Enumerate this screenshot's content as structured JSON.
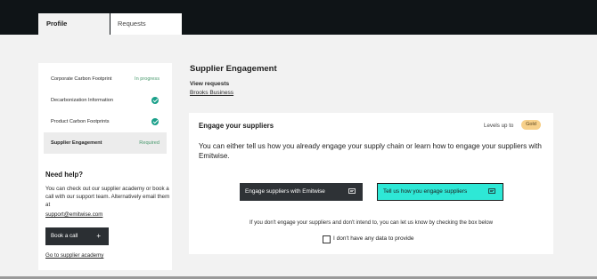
{
  "tabs": {
    "profile": "Profile",
    "requests": "Requests"
  },
  "sidebar": {
    "steps": [
      {
        "label": "Corporate Carbon Footprint",
        "status": "In progress"
      },
      {
        "label": "Decarbonization Information",
        "status": "complete"
      },
      {
        "label": "Product Carbon Footprints",
        "status": "complete"
      },
      {
        "label": "Supplier Engagement",
        "status": "Required"
      }
    ],
    "help": {
      "title": "Need help?",
      "text": "You can check out our supplier academy or book a call with our support team. Alternatively email them at",
      "email": "support@emitwise.com",
      "book_label": "Book a call",
      "book_icon": "+",
      "academy_link": "Go to supplier academy"
    }
  },
  "main": {
    "title": "Supplier Engagement",
    "view_requests": "View requests",
    "company": "Brooks Business",
    "card": {
      "title": "Engage your suppliers",
      "levels_label": "Levels up to",
      "badge": "Gold",
      "description": "You can either tell us how you already engage your supply chain or learn how to engage your suppliers with Emitwise.",
      "btn_emitwise": "Engage suppliers with Emitwise",
      "btn_tell": "Tell us how you engage suppliers",
      "note": "If you don't engage your suppliers and don't intend to, you can let us know by checking the box below",
      "checkbox_label": "I don't have any data to provide"
    }
  },
  "colors": {
    "topbar": "#0f1417",
    "accent_teal": "#2ee8d6",
    "check_green": "#1aa08a",
    "badge_gold": "#f7d08a",
    "dark_button": "#2e3236"
  }
}
